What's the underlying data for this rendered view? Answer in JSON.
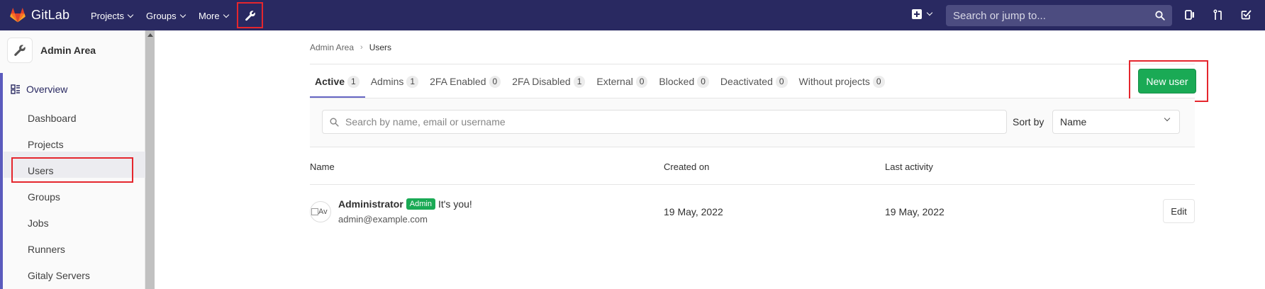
{
  "topbar": {
    "app_name": "GitLab",
    "nav": [
      {
        "label": "Projects"
      },
      {
        "label": "Groups"
      },
      {
        "label": "More"
      }
    ],
    "search_placeholder": "Search or jump to...",
    "colors": {
      "background": "#292961",
      "search_bg": "#4c4c80"
    }
  },
  "sidebar": {
    "title": "Admin Area",
    "section": "Overview",
    "items": [
      {
        "label": "Dashboard"
      },
      {
        "label": "Projects"
      },
      {
        "label": "Users"
      },
      {
        "label": "Groups"
      },
      {
        "label": "Jobs"
      },
      {
        "label": "Runners"
      },
      {
        "label": "Gitaly Servers"
      }
    ]
  },
  "breadcrumb": {
    "parent": "Admin Area",
    "current": "Users"
  },
  "tabs": [
    {
      "label": "Active",
      "count": "1"
    },
    {
      "label": "Admins",
      "count": "1"
    },
    {
      "label": "2FA Enabled",
      "count": "0"
    },
    {
      "label": "2FA Disabled",
      "count": "1"
    },
    {
      "label": "External",
      "count": "0"
    },
    {
      "label": "Blocked",
      "count": "0"
    },
    {
      "label": "Deactivated",
      "count": "0"
    },
    {
      "label": "Without projects",
      "count": "0"
    }
  ],
  "new_user_label": "New user",
  "filter": {
    "search_placeholder": "Search by name, email or username",
    "sort_label": "Sort by",
    "sort_value": "Name"
  },
  "table": {
    "headers": {
      "name": "Name",
      "created": "Created on",
      "last_activity": "Last activity"
    },
    "rows": [
      {
        "avatar_alt": "Av",
        "name": "Administrator",
        "badge": "Admin",
        "note": "It's you!",
        "email": "admin@example.com",
        "created": "19 May, 2022",
        "last_activity": "19 May, 2022",
        "action": "Edit"
      }
    ]
  },
  "accent_colors": {
    "primary": "#1aaa55",
    "highlight": "#e5262d",
    "tab_underline": "#6666c4"
  }
}
